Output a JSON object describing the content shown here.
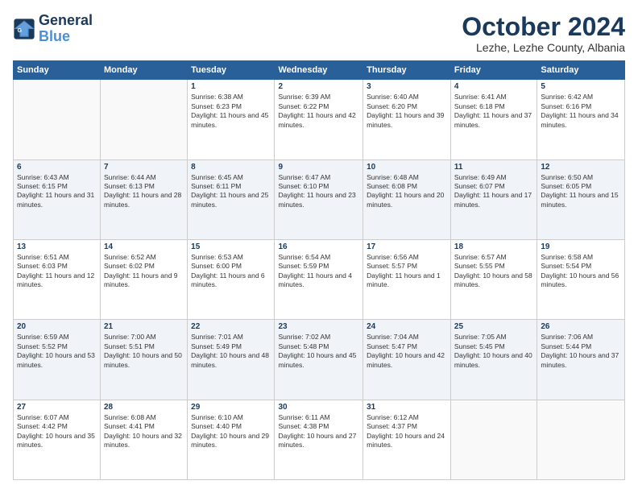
{
  "logo": {
    "line1": "General",
    "line2": "Blue"
  },
  "title": "October 2024",
  "location": "Lezhe, Lezhe County, Albania",
  "days_of_week": [
    "Sunday",
    "Monday",
    "Tuesday",
    "Wednesday",
    "Thursday",
    "Friday",
    "Saturday"
  ],
  "weeks": [
    [
      {
        "day": "",
        "info": ""
      },
      {
        "day": "",
        "info": ""
      },
      {
        "day": "1",
        "info": "Sunrise: 6:38 AM\nSunset: 6:23 PM\nDaylight: 11 hours and 45 minutes."
      },
      {
        "day": "2",
        "info": "Sunrise: 6:39 AM\nSunset: 6:22 PM\nDaylight: 11 hours and 42 minutes."
      },
      {
        "day": "3",
        "info": "Sunrise: 6:40 AM\nSunset: 6:20 PM\nDaylight: 11 hours and 39 minutes."
      },
      {
        "day": "4",
        "info": "Sunrise: 6:41 AM\nSunset: 6:18 PM\nDaylight: 11 hours and 37 minutes."
      },
      {
        "day": "5",
        "info": "Sunrise: 6:42 AM\nSunset: 6:16 PM\nDaylight: 11 hours and 34 minutes."
      }
    ],
    [
      {
        "day": "6",
        "info": "Sunrise: 6:43 AM\nSunset: 6:15 PM\nDaylight: 11 hours and 31 minutes."
      },
      {
        "day": "7",
        "info": "Sunrise: 6:44 AM\nSunset: 6:13 PM\nDaylight: 11 hours and 28 minutes."
      },
      {
        "day": "8",
        "info": "Sunrise: 6:45 AM\nSunset: 6:11 PM\nDaylight: 11 hours and 25 minutes."
      },
      {
        "day": "9",
        "info": "Sunrise: 6:47 AM\nSunset: 6:10 PM\nDaylight: 11 hours and 23 minutes."
      },
      {
        "day": "10",
        "info": "Sunrise: 6:48 AM\nSunset: 6:08 PM\nDaylight: 11 hours and 20 minutes."
      },
      {
        "day": "11",
        "info": "Sunrise: 6:49 AM\nSunset: 6:07 PM\nDaylight: 11 hours and 17 minutes."
      },
      {
        "day": "12",
        "info": "Sunrise: 6:50 AM\nSunset: 6:05 PM\nDaylight: 11 hours and 15 minutes."
      }
    ],
    [
      {
        "day": "13",
        "info": "Sunrise: 6:51 AM\nSunset: 6:03 PM\nDaylight: 11 hours and 12 minutes."
      },
      {
        "day": "14",
        "info": "Sunrise: 6:52 AM\nSunset: 6:02 PM\nDaylight: 11 hours and 9 minutes."
      },
      {
        "day": "15",
        "info": "Sunrise: 6:53 AM\nSunset: 6:00 PM\nDaylight: 11 hours and 6 minutes."
      },
      {
        "day": "16",
        "info": "Sunrise: 6:54 AM\nSunset: 5:59 PM\nDaylight: 11 hours and 4 minutes."
      },
      {
        "day": "17",
        "info": "Sunrise: 6:56 AM\nSunset: 5:57 PM\nDaylight: 11 hours and 1 minute."
      },
      {
        "day": "18",
        "info": "Sunrise: 6:57 AM\nSunset: 5:55 PM\nDaylight: 10 hours and 58 minutes."
      },
      {
        "day": "19",
        "info": "Sunrise: 6:58 AM\nSunset: 5:54 PM\nDaylight: 10 hours and 56 minutes."
      }
    ],
    [
      {
        "day": "20",
        "info": "Sunrise: 6:59 AM\nSunset: 5:52 PM\nDaylight: 10 hours and 53 minutes."
      },
      {
        "day": "21",
        "info": "Sunrise: 7:00 AM\nSunset: 5:51 PM\nDaylight: 10 hours and 50 minutes."
      },
      {
        "day": "22",
        "info": "Sunrise: 7:01 AM\nSunset: 5:49 PM\nDaylight: 10 hours and 48 minutes."
      },
      {
        "day": "23",
        "info": "Sunrise: 7:02 AM\nSunset: 5:48 PM\nDaylight: 10 hours and 45 minutes."
      },
      {
        "day": "24",
        "info": "Sunrise: 7:04 AM\nSunset: 5:47 PM\nDaylight: 10 hours and 42 minutes."
      },
      {
        "day": "25",
        "info": "Sunrise: 7:05 AM\nSunset: 5:45 PM\nDaylight: 10 hours and 40 minutes."
      },
      {
        "day": "26",
        "info": "Sunrise: 7:06 AM\nSunset: 5:44 PM\nDaylight: 10 hours and 37 minutes."
      }
    ],
    [
      {
        "day": "27",
        "info": "Sunrise: 6:07 AM\nSunset: 4:42 PM\nDaylight: 10 hours and 35 minutes."
      },
      {
        "day": "28",
        "info": "Sunrise: 6:08 AM\nSunset: 4:41 PM\nDaylight: 10 hours and 32 minutes."
      },
      {
        "day": "29",
        "info": "Sunrise: 6:10 AM\nSunset: 4:40 PM\nDaylight: 10 hours and 29 minutes."
      },
      {
        "day": "30",
        "info": "Sunrise: 6:11 AM\nSunset: 4:38 PM\nDaylight: 10 hours and 27 minutes."
      },
      {
        "day": "31",
        "info": "Sunrise: 6:12 AM\nSunset: 4:37 PM\nDaylight: 10 hours and 24 minutes."
      },
      {
        "day": "",
        "info": ""
      },
      {
        "day": "",
        "info": ""
      }
    ]
  ]
}
